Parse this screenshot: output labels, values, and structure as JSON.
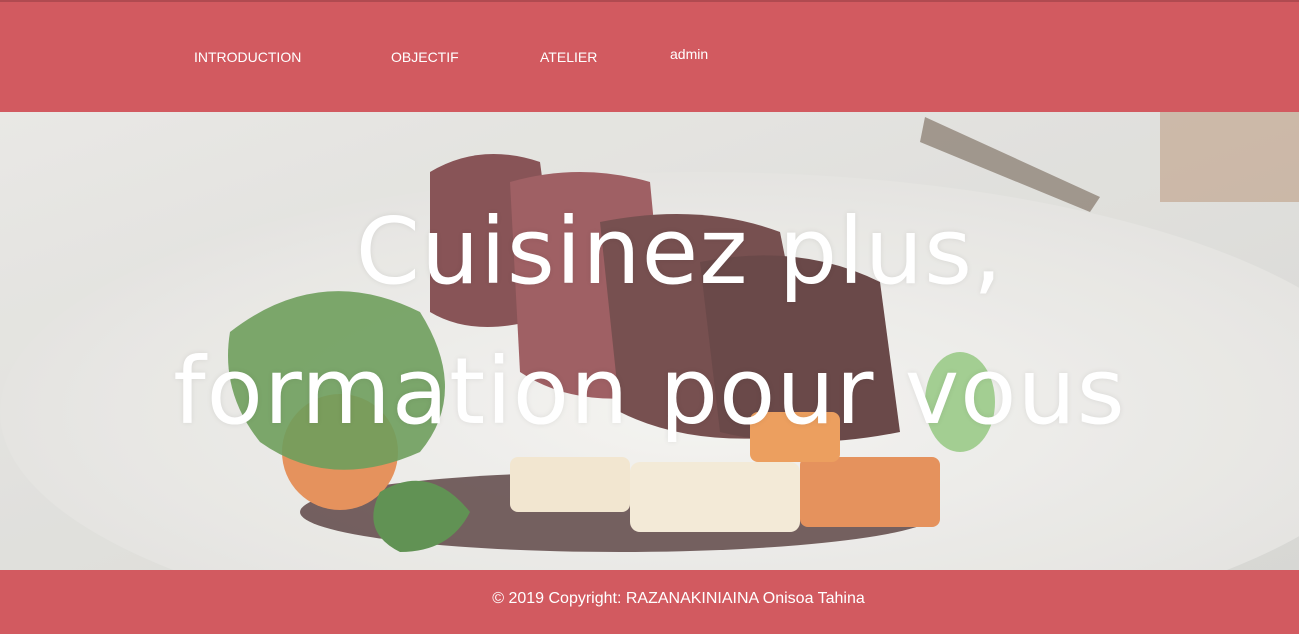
{
  "nav": {
    "introduction": "INTRODUCTION",
    "objectif": "OBJECTIF",
    "atelier": "ATELIER",
    "admin": "admin"
  },
  "hero": {
    "line_1": "Cuisinez plus,",
    "line_2": "formation pour vous"
  },
  "footer": {
    "copyright": "© 2019 Copyright: RAZANAKINIAINA Onisoa Tahina"
  },
  "colors": {
    "brand_bar": "#d25a60",
    "text_on_brand": "#ffffff"
  }
}
